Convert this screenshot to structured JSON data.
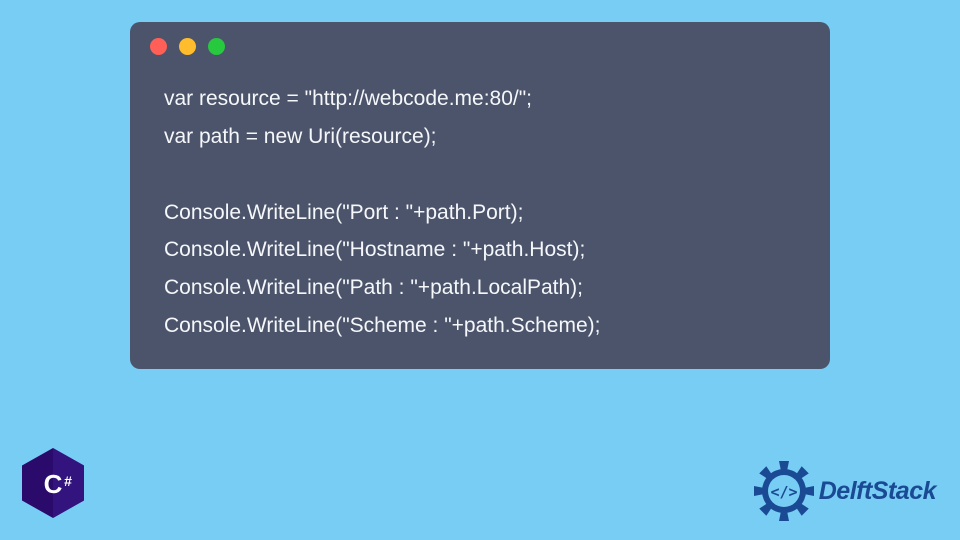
{
  "code": {
    "lines": [
      "var resource = \"http://webcode.me:80/\";",
      "var path = new Uri(resource);",
      "",
      "Console.WriteLine(\"Port : \"+path.Port);",
      "Console.WriteLine(\"Hostname : \"+path.Host);",
      "Console.WriteLine(\"Path : \"+path.LocalPath);",
      "Console.WriteLine(\"Scheme : \"+path.Scheme);"
    ]
  },
  "badge": {
    "label": "C#",
    "color": "#2a0a6b"
  },
  "brand": {
    "name": "DelftStack",
    "accent": "#1a4a93"
  },
  "window_controls": {
    "red": "#ff5f56",
    "yellow": "#ffbd2e",
    "green": "#27c93f"
  }
}
